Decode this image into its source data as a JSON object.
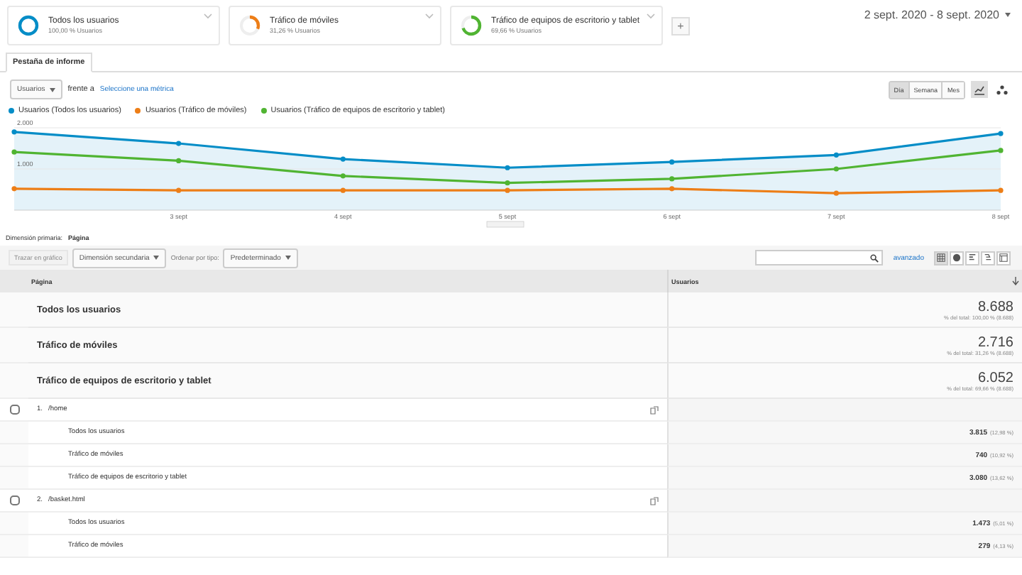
{
  "segments": [
    {
      "title": "Todos los usuarios",
      "subtitle": "100,00 % Usuarios",
      "level": 1,
      "color": "#058dc7"
    },
    {
      "title": "Tráfico de móviles",
      "subtitle": "31,26 % Usuarios",
      "level": 0.3126,
      "color": "#ed7e17"
    },
    {
      "title": "Tráfico de equipos de escritorio y tablet",
      "subtitle": "69,66 % Usuarios",
      "level": 0.6966,
      "color": "#50b432"
    }
  ],
  "add_segment": "+",
  "date_range": "2 sept. 2020 - 8 sept. 2020",
  "report_tab": "Pestaña de informe",
  "metric": {
    "value": "Usuarios",
    "versus": "frente a",
    "link": "Seleccione una métrica"
  },
  "intervals": [
    {
      "label": "Día",
      "selected": true
    },
    {
      "label": "Semana",
      "selected": false
    },
    {
      "label": "Mes",
      "selected": false
    }
  ],
  "chart_types": [
    {
      "kind": "line",
      "selected": true
    },
    {
      "kind": "motion",
      "selected": false
    }
  ],
  "chart_data": {
    "type": "line",
    "categories": [
      null,
      "3 sept",
      "4 sept",
      "5 sept",
      "6 sept",
      "7 sept",
      "8 sept"
    ],
    "ylim": [
      0,
      2000
    ],
    "yticks": [
      {
        "value": 1000,
        "label": "1.000"
      },
      {
        "value": 2000,
        "label": "2.000"
      }
    ],
    "series": [
      {
        "name": "Usuarios (Todos los usuarios)",
        "color": "#058dc7",
        "type": "area",
        "marker": "circle",
        "values": [
          1900,
          1620,
          1240,
          1030,
          1170,
          1340,
          1860
        ]
      },
      {
        "name": "Usuarios (Tráfico de móviles)",
        "color": "#ed7e17",
        "marker": "circle",
        "values": [
          520,
          480,
          480,
          480,
          520,
          410,
          480
        ]
      },
      {
        "name": "Usuarios (Tráfico de equipos de escritorio y tablet)",
        "color": "#50b432",
        "marker": "circle",
        "values": [
          1410,
          1200,
          830,
          660,
          760,
          1000,
          1450
        ]
      }
    ]
  },
  "primary_dimension": {
    "label": "Dimensión primaria:",
    "value": "Página"
  },
  "toolbar": {
    "plot_rows": "Trazar en gráfico",
    "secondary": "Dimensión secundaria",
    "sort_label": "Ordenar por tipo:",
    "sort": "Predeterminado",
    "advanced": "avanzado"
  },
  "views": [
    {
      "kind": "table",
      "selected": true
    },
    {
      "kind": "pie",
      "selected": false
    },
    {
      "kind": "bars",
      "selected": false
    },
    {
      "kind": "compare",
      "selected": false
    },
    {
      "kind": "pivot",
      "selected": false
    }
  ],
  "table": {
    "columns": [
      "Página",
      "Usuarios"
    ],
    "totals": [
      {
        "label": "Todos los usuarios",
        "value": "8.688",
        "share": "% del total: 100,00 % (8.688)"
      },
      {
        "label": "Tráfico de móviles",
        "value": "2.716",
        "share": "% del total: 31,26 % (8.688)"
      },
      {
        "label": "Tráfico de equipos de escritorio y tablet",
        "value": "6.052",
        "share": "% del total: 69,66 % (8.688)"
      }
    ],
    "rows": [
      {
        "index": "1.",
        "page": "/home",
        "checked": false,
        "segments": [
          {
            "label": "Todos los usuarios",
            "value": "3.815",
            "pct": "(12,98 %)"
          },
          {
            "label": "Tráfico de móviles",
            "value": "740",
            "pct": "(10,92 %)"
          },
          {
            "label": "Tráfico de equipos de escritorio y tablet",
            "value": "3.080",
            "pct": "(13,62 %)"
          }
        ]
      },
      {
        "index": "2.",
        "page": "/basket.html",
        "checked": false,
        "segments": [
          {
            "label": "Todos los usuarios",
            "value": "1.473",
            "pct": "(5,01 %)"
          },
          {
            "label": "Tráfico de móviles",
            "value": "279",
            "pct": "(4,13 %)"
          }
        ]
      }
    ]
  }
}
